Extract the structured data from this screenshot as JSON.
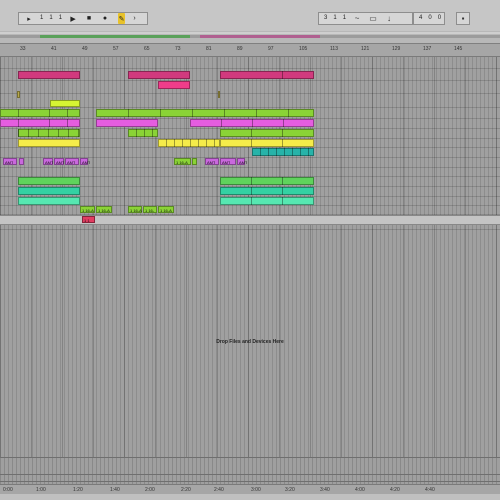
{
  "transport": {
    "position": [
      "1",
      "1",
      "1"
    ],
    "loop_start": [
      "3",
      "1",
      "1"
    ],
    "loop_length": [
      "4",
      "0",
      "0"
    ],
    "play_icon": "play-icon",
    "stop_icon": "stop-icon",
    "record_icon": "record-icon",
    "add_icon": "plus-icon",
    "draw_icon": "draw-mode-icon",
    "accent": "#e8c22a"
  },
  "ruler": {
    "bars": [
      "33",
      "41",
      "49",
      "57",
      "65",
      "73",
      "81",
      "89",
      "97",
      "105",
      "113",
      "121",
      "129",
      "137",
      "145"
    ]
  },
  "time_ruler": {
    "labels": [
      "0:00",
      "1:00",
      "1:20",
      "1:40",
      "2:00",
      "2:20",
      "2:40",
      "3:00",
      "3:20",
      "3:40",
      "4:00",
      "4:20",
      "4:40"
    ]
  },
  "drop_hint": "Drop Files and Devices Here",
  "clip_labels": {
    "amt": "AMT",
    "audio_a": "1 16-A",
    "audio_b": "1 16-",
    "audio_c": "1 1"
  },
  "colors": {
    "pink": "#d13a7e",
    "hot_pink": "#f03d8a",
    "olive": "#b7a94c",
    "lime": "#b7e22e",
    "green": "#8ad336",
    "magenta": "#e55de0",
    "yellow": "#f5ec4a",
    "teal": "#27b3a9",
    "violet": "#c968dd",
    "bright_green": "#5fd35c",
    "mint": "#34d1a3",
    "seafoam": "#56e7b1",
    "red": "#e23d61"
  }
}
